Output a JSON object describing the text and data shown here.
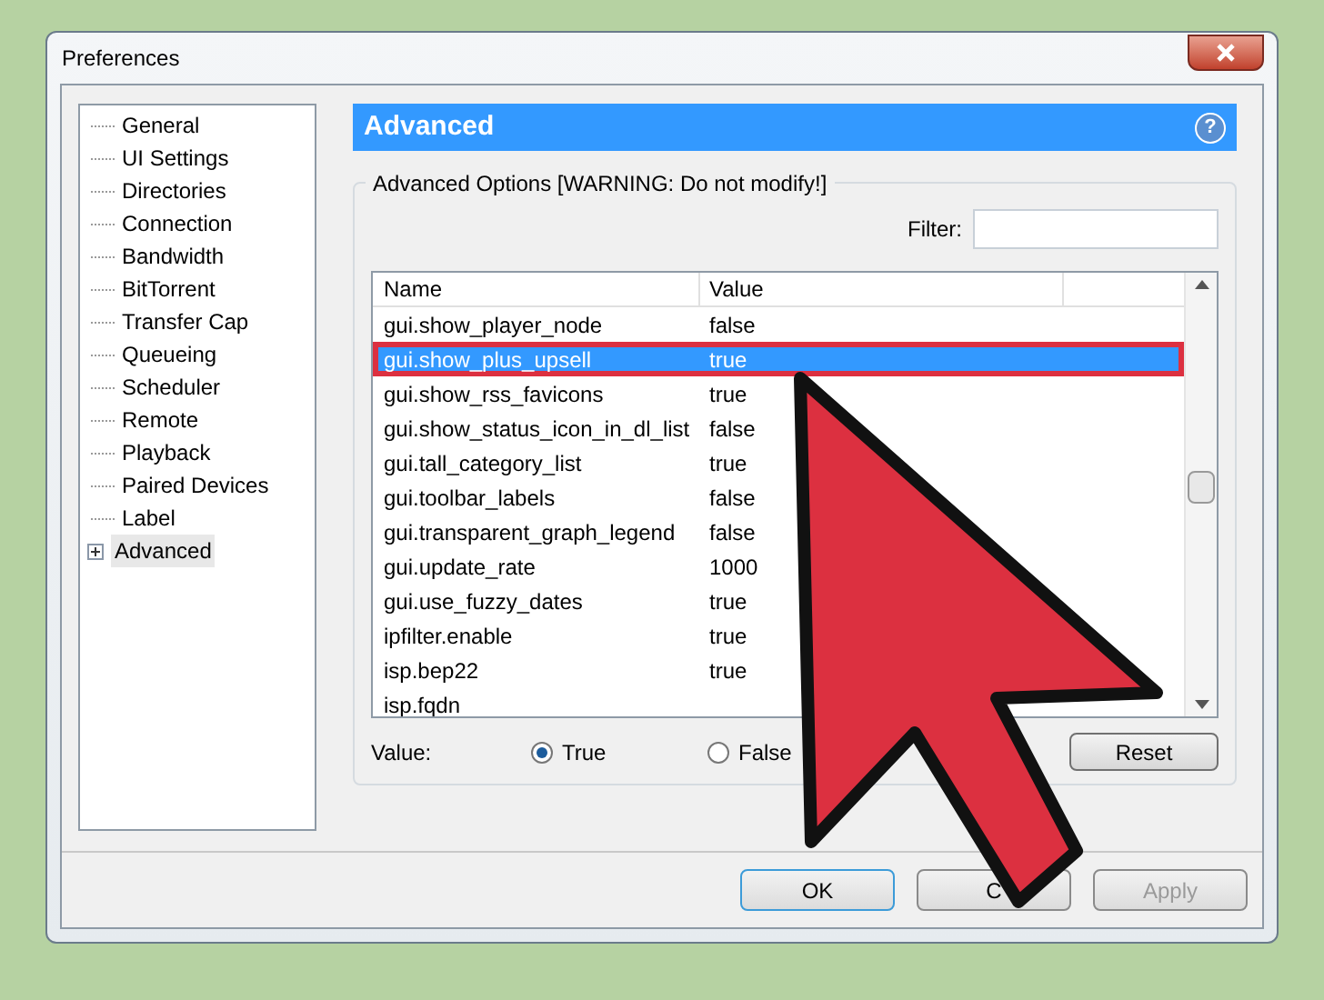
{
  "window": {
    "title": "Preferences"
  },
  "sidebar": {
    "items": [
      {
        "label": "General",
        "selected": false
      },
      {
        "label": "UI Settings",
        "selected": false
      },
      {
        "label": "Directories",
        "selected": false
      },
      {
        "label": "Connection",
        "selected": false
      },
      {
        "label": "Bandwidth",
        "selected": false
      },
      {
        "label": "BitTorrent",
        "selected": false
      },
      {
        "label": "Transfer Cap",
        "selected": false
      },
      {
        "label": "Queueing",
        "selected": false
      },
      {
        "label": "Scheduler",
        "selected": false
      },
      {
        "label": "Remote",
        "selected": false
      },
      {
        "label": "Playback",
        "selected": false
      },
      {
        "label": "Paired Devices",
        "selected": false
      },
      {
        "label": "Label",
        "selected": false
      },
      {
        "label": "Advanced",
        "selected": true,
        "expandable": true
      }
    ]
  },
  "panel": {
    "title": "Advanced",
    "help": "?",
    "group_title": "Advanced Options [WARNING: Do not modify!]",
    "filter": {
      "label": "Filter:"
    },
    "table": {
      "columns": [
        "Name",
        "Value"
      ],
      "rows": [
        {
          "name": "gui.show_player_node",
          "value": "false",
          "selected": false
        },
        {
          "name": "gui.show_plus_upsell",
          "value": "true",
          "selected": true
        },
        {
          "name": "gui.show_rss_favicons",
          "value": "true",
          "selected": false
        },
        {
          "name": "gui.show_status_icon_in_dl_list",
          "value": "false",
          "selected": false
        },
        {
          "name": "gui.tall_category_list",
          "value": "true",
          "selected": false
        },
        {
          "name": "gui.toolbar_labels",
          "value": "false",
          "selected": false
        },
        {
          "name": "gui.transparent_graph_legend",
          "value": "false",
          "selected": false
        },
        {
          "name": "gui.update_rate",
          "value": "1000",
          "selected": false
        },
        {
          "name": "gui.use_fuzzy_dates",
          "value": "true",
          "selected": false
        },
        {
          "name": "ipfilter.enable",
          "value": "true",
          "selected": false
        },
        {
          "name": "isp.bep22",
          "value": "true",
          "selected": false
        },
        {
          "name": "isp.fqdn",
          "value": "",
          "selected": false
        }
      ]
    },
    "value_label": "Value:",
    "options": [
      {
        "label": "True",
        "selected": true
      },
      {
        "label": "False",
        "selected": false
      }
    ],
    "reset": "Reset"
  },
  "buttons": [
    {
      "label": "OK",
      "disabled": false
    },
    {
      "label": "C",
      "disabled": false
    },
    {
      "label": "Apply",
      "disabled": true
    }
  ]
}
